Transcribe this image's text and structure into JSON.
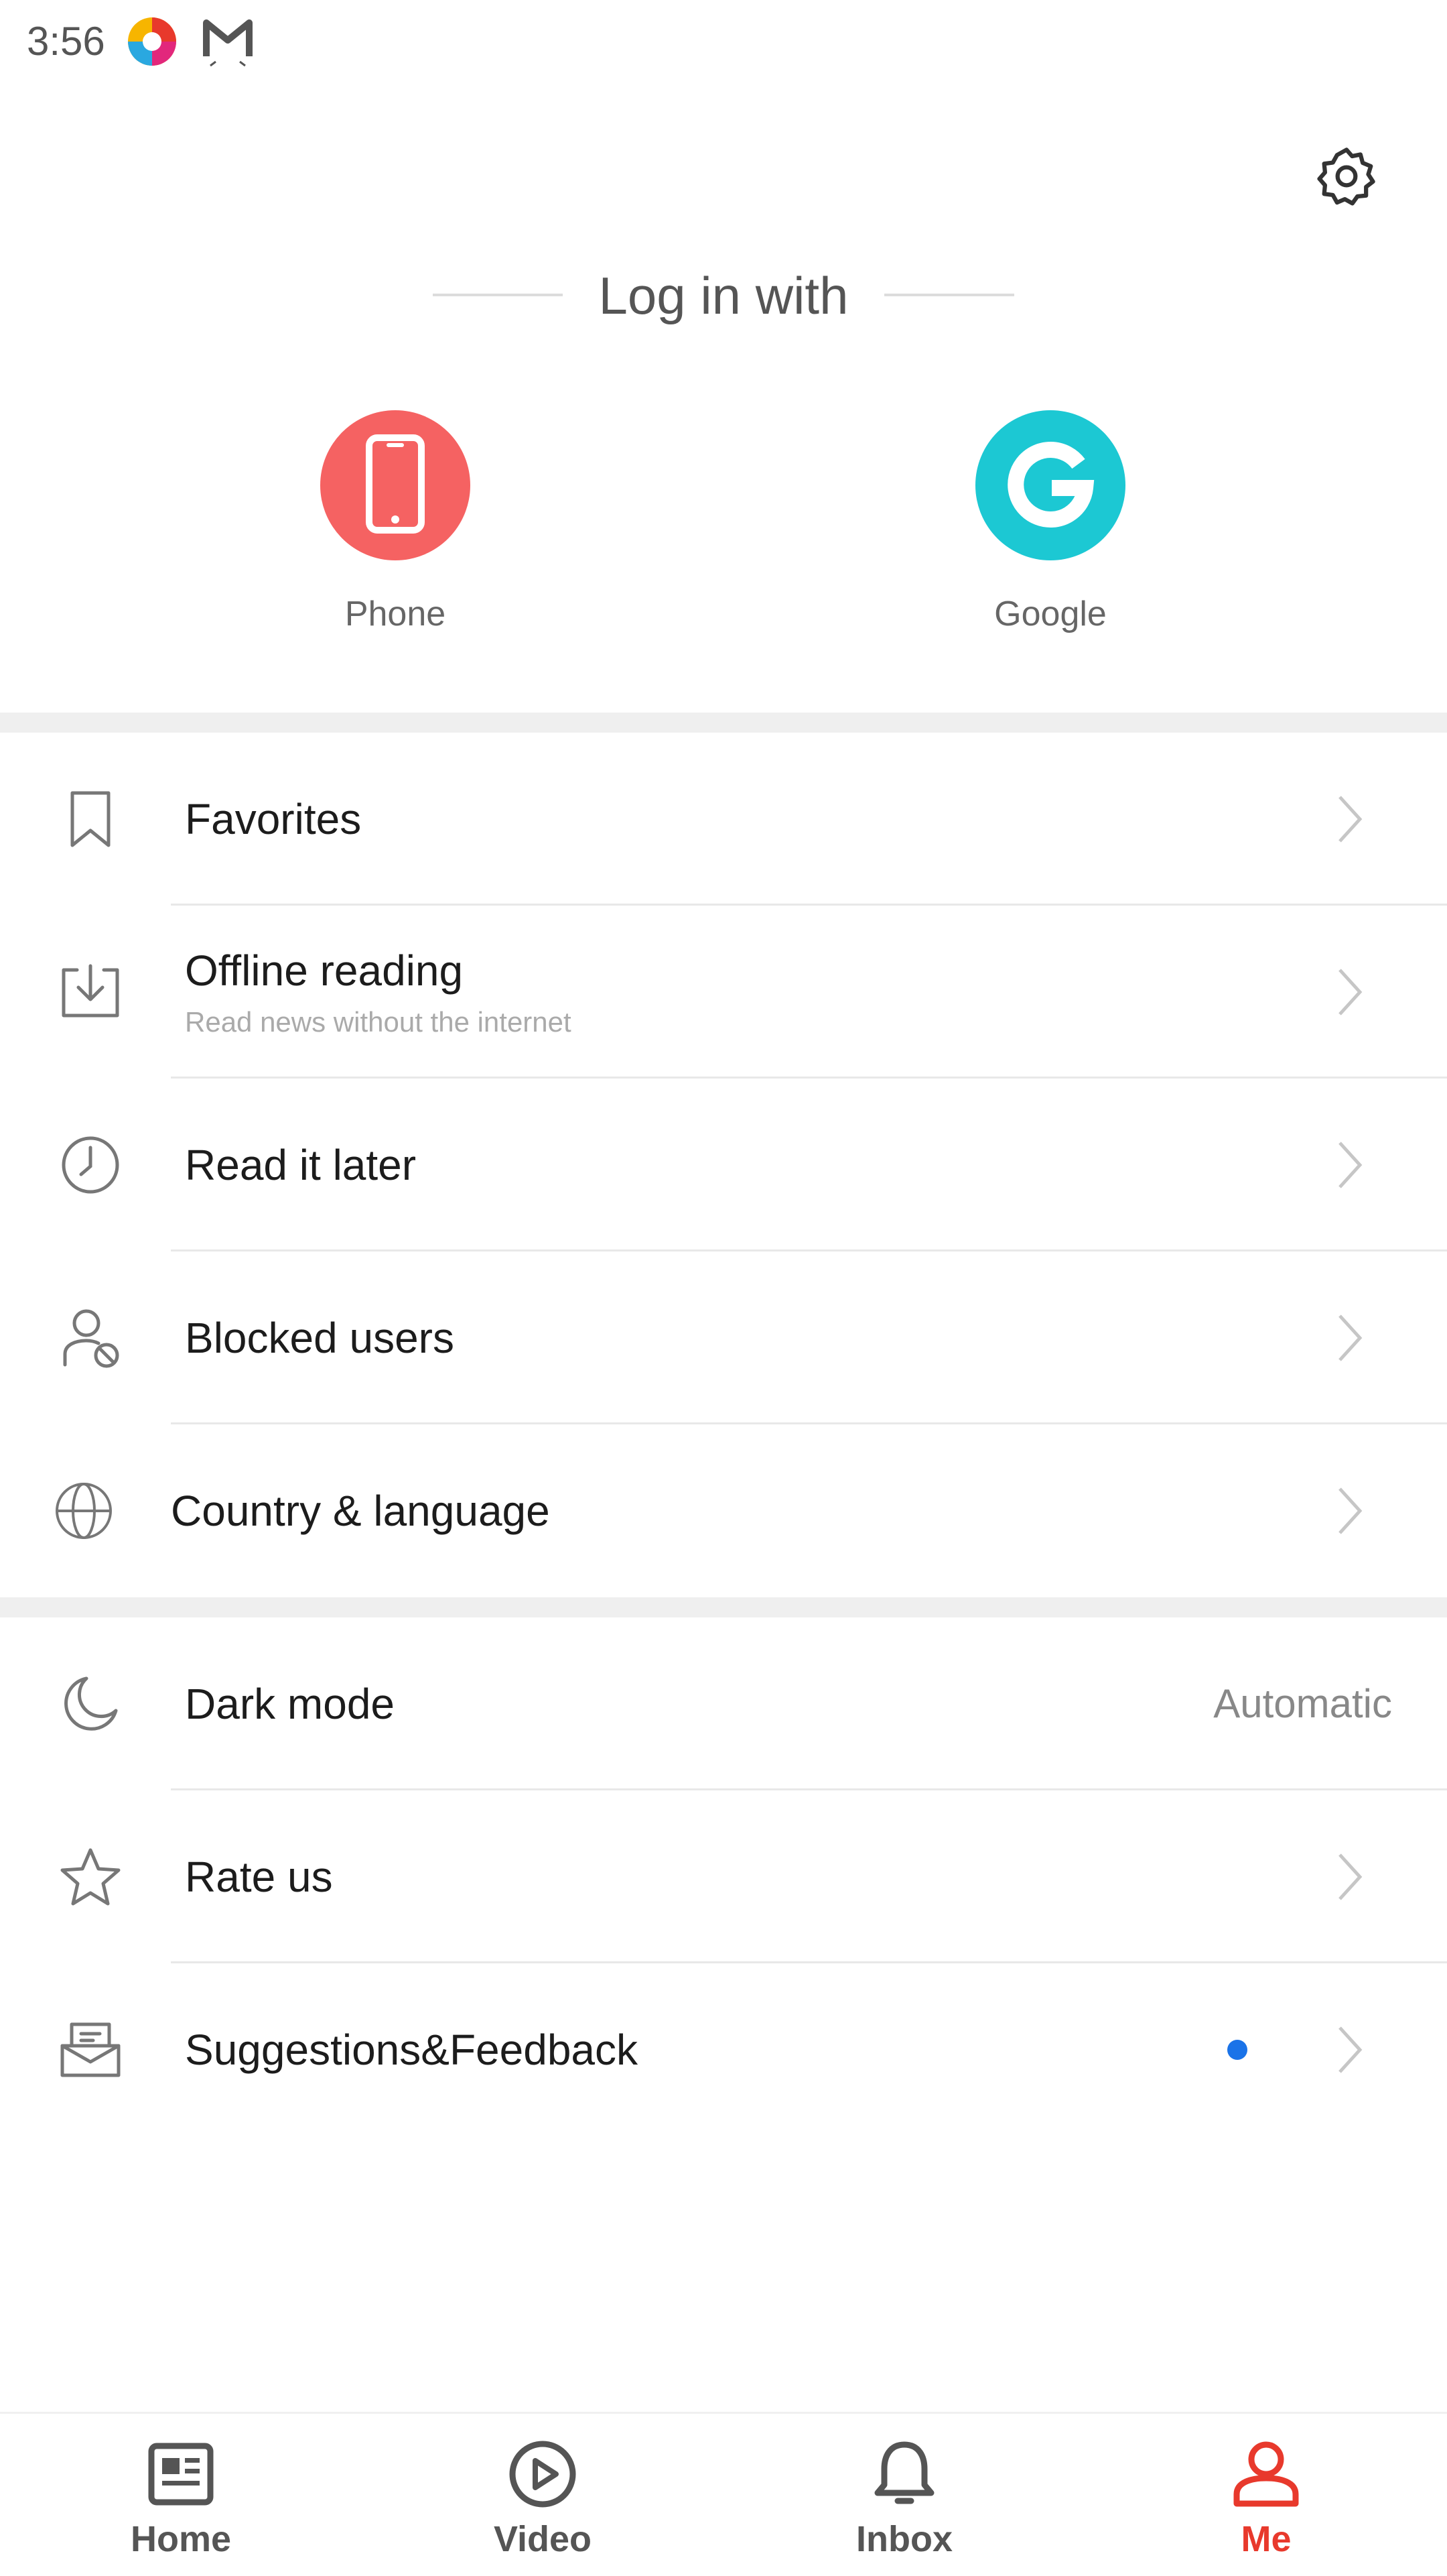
{
  "status_bar": {
    "time": "3:56",
    "icons": [
      "colorful-app-icon",
      "gmail-icon"
    ]
  },
  "header": {
    "settings_icon": "gear-icon",
    "login_title": "Log in with"
  },
  "login_options": [
    {
      "label": "Phone",
      "icon": "smartphone-icon",
      "color": "#f56262"
    },
    {
      "label": "Google",
      "icon": "google-g-icon",
      "color": "#1cc8d3"
    }
  ],
  "menu_group_1": [
    {
      "title": "Favorites",
      "icon": "bookmark-icon"
    },
    {
      "title": "Offline reading",
      "subtitle": "Read news without the internet",
      "icon": "download-tray-icon"
    },
    {
      "title": "Read it later",
      "icon": "clock-icon"
    },
    {
      "title": "Blocked users",
      "icon": "blocked-user-icon"
    },
    {
      "title": "Country & language",
      "icon": "globe-icon"
    }
  ],
  "menu_group_2": [
    {
      "title": "Dark mode",
      "value": "Automatic",
      "icon": "moon-icon"
    },
    {
      "title": "Rate us",
      "icon": "star-icon"
    },
    {
      "title": "Suggestions&Feedback",
      "icon": "envelope-open-icon",
      "badge_color": "#1a73e8"
    }
  ],
  "bottom_nav": [
    {
      "label": "Home",
      "icon": "newspaper-icon",
      "active": false
    },
    {
      "label": "Video",
      "icon": "play-circle-icon",
      "active": false
    },
    {
      "label": "Inbox",
      "icon": "bell-icon",
      "active": false
    },
    {
      "label": "Me",
      "icon": "person-icon",
      "active": true
    }
  ],
  "colors": {
    "accent": "#e8392c",
    "inactive_nav": "#555555",
    "divider": "#efefef"
  }
}
